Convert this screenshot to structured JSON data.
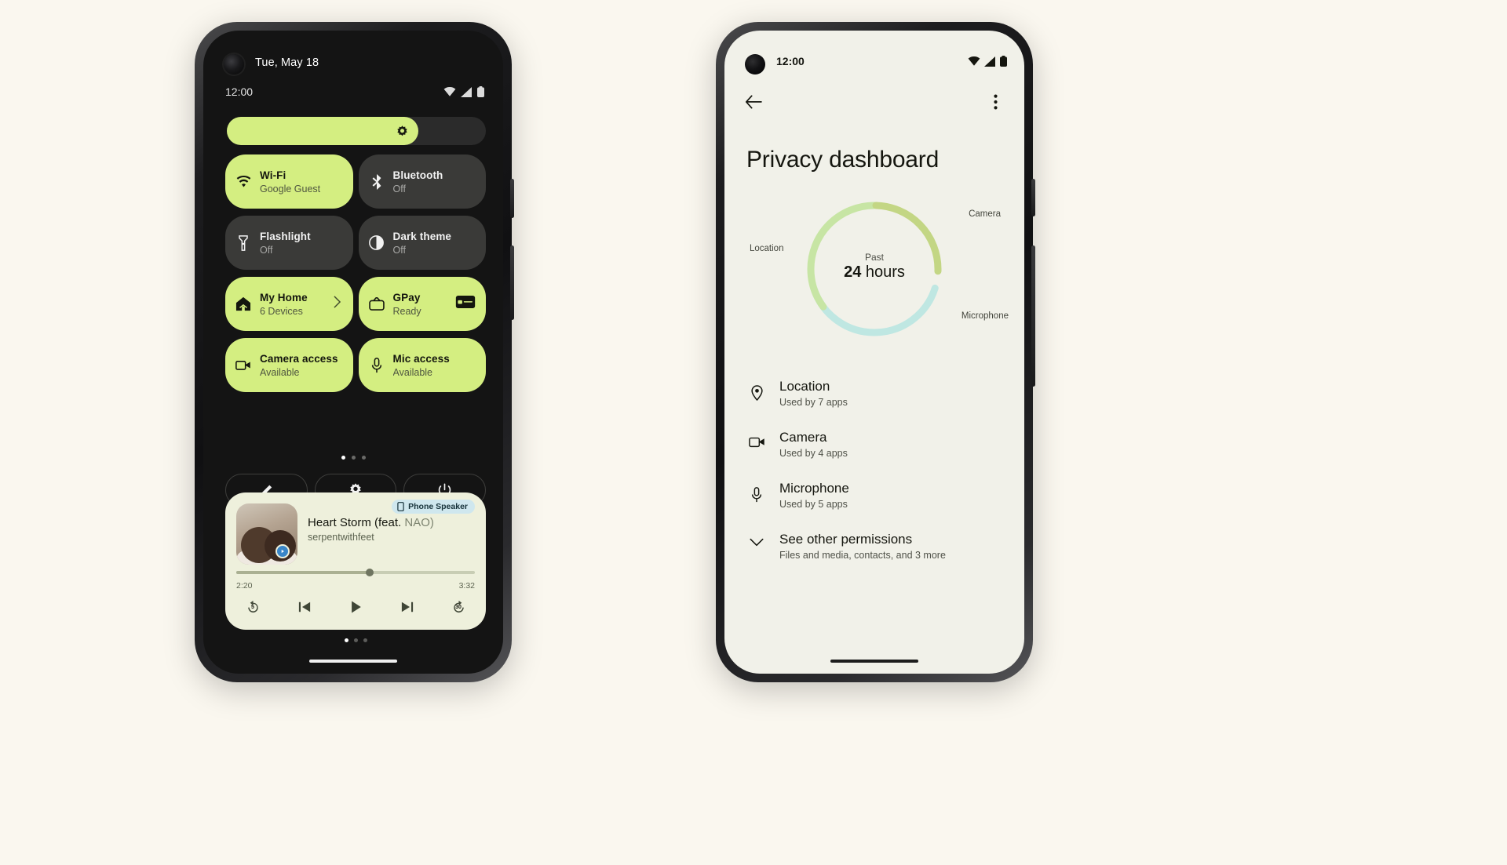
{
  "scene": {
    "background_color": "#faf7ef",
    "accent_green": "#d4ee81",
    "dark_surface": "#141414",
    "tile_off": "#3a3a38",
    "light_surface": "#f1f1e9",
    "media_surface": "#eef0dc"
  },
  "left_phone": {
    "quick_settings": {
      "date": "Tue, May 18",
      "time": "12:00",
      "status_icons": [
        "wifi-icon",
        "signal-icon",
        "battery-icon"
      ],
      "brightness": {
        "name": "brightness-slider",
        "icon": "brightness-icon",
        "value_percent": 74
      },
      "tiles": [
        {
          "title": "Wi-Fi",
          "subtitle": "Google Guest",
          "state": "on",
          "icon": "wifi-icon",
          "trailing": ""
        },
        {
          "title": "Bluetooth",
          "subtitle": "Off",
          "state": "off",
          "icon": "bluetooth-icon",
          "trailing": ""
        },
        {
          "title": "Flashlight",
          "subtitle": "Off",
          "state": "off",
          "icon": "flashlight-icon",
          "trailing": ""
        },
        {
          "title": "Dark theme",
          "subtitle": "Off",
          "state": "off",
          "icon": "contrast-icon",
          "trailing": ""
        },
        {
          "title": "My Home",
          "subtitle": "6 Devices",
          "state": "on",
          "icon": "home-icon",
          "trailing": "chevron-right-icon"
        },
        {
          "title": "GPay",
          "subtitle": "Ready",
          "state": "on",
          "icon": "wallet-icon",
          "trailing": "card-icon"
        },
        {
          "title": "Camera access",
          "subtitle": "Available",
          "state": "on",
          "icon": "videocam-icon",
          "trailing": ""
        },
        {
          "title": "Mic access",
          "subtitle": "Available",
          "state": "on",
          "icon": "mic-icon",
          "trailing": ""
        }
      ],
      "page_dots": {
        "count": 3,
        "active_index": 0
      },
      "actions": [
        {
          "name": "edit-tiles-button",
          "icon": "pencil-icon"
        },
        {
          "name": "settings-button",
          "icon": "gear-icon"
        },
        {
          "name": "power-button",
          "icon": "power-icon"
        }
      ]
    },
    "media_player": {
      "title": "Heart Storm (feat.",
      "title_feature": "NAO)",
      "artist": "serpentwithfeet",
      "output_chip": {
        "label": "Phone Speaker",
        "icon": "phone-icon"
      },
      "elapsed": "2:20",
      "duration": "3:32",
      "progress_percent": 56,
      "controls": [
        {
          "name": "rewind-5-button",
          "icon": "replay-icon",
          "badge": "5"
        },
        {
          "name": "previous-button",
          "icon": "skip-prev-icon",
          "badge": ""
        },
        {
          "name": "play-button",
          "icon": "play-icon",
          "badge": ""
        },
        {
          "name": "next-button",
          "icon": "skip-next-icon",
          "badge": ""
        },
        {
          "name": "forward-30-button",
          "icon": "forward-icon",
          "badge": "30"
        }
      ],
      "page_dots": {
        "count": 3,
        "active_index": 0
      }
    }
  },
  "right_phone": {
    "status": {
      "time": "12:00",
      "status_icons": [
        "wifi-icon",
        "signal-icon",
        "battery-icon"
      ]
    },
    "appbar": {
      "back": "back-arrow-icon",
      "overflow": "more-vert-icon"
    },
    "page_title": "Privacy dashboard",
    "chart_data": {
      "type": "pie",
      "title": "Past 24 hours",
      "center_line1": "Past",
      "center_number": "24",
      "center_unit": "hours",
      "labels": [
        "Camera",
        "Microphone",
        "Location"
      ],
      "legend_position": "around-donut",
      "series": [
        {
          "name": "Camera",
          "value": 25,
          "color": "#c9dd8e"
        },
        {
          "name": "Microphone",
          "value": 35,
          "color": "#c3e3b8"
        },
        {
          "name": "Location",
          "value": 40,
          "color": "#bfe7e2"
        }
      ]
    },
    "permissions": [
      {
        "title": "Location",
        "subtitle": "Used by 7 apps",
        "icon": "location-pin-icon"
      },
      {
        "title": "Camera",
        "subtitle": "Used by 4 apps",
        "icon": "videocam-icon"
      },
      {
        "title": "Microphone",
        "subtitle": "Used by 5 apps",
        "icon": "mic-icon"
      }
    ],
    "other_permissions": {
      "title": "See other permissions",
      "subtitle": "Files and media, contacts, and 3 more",
      "icon": "chevron-down-icon"
    }
  }
}
